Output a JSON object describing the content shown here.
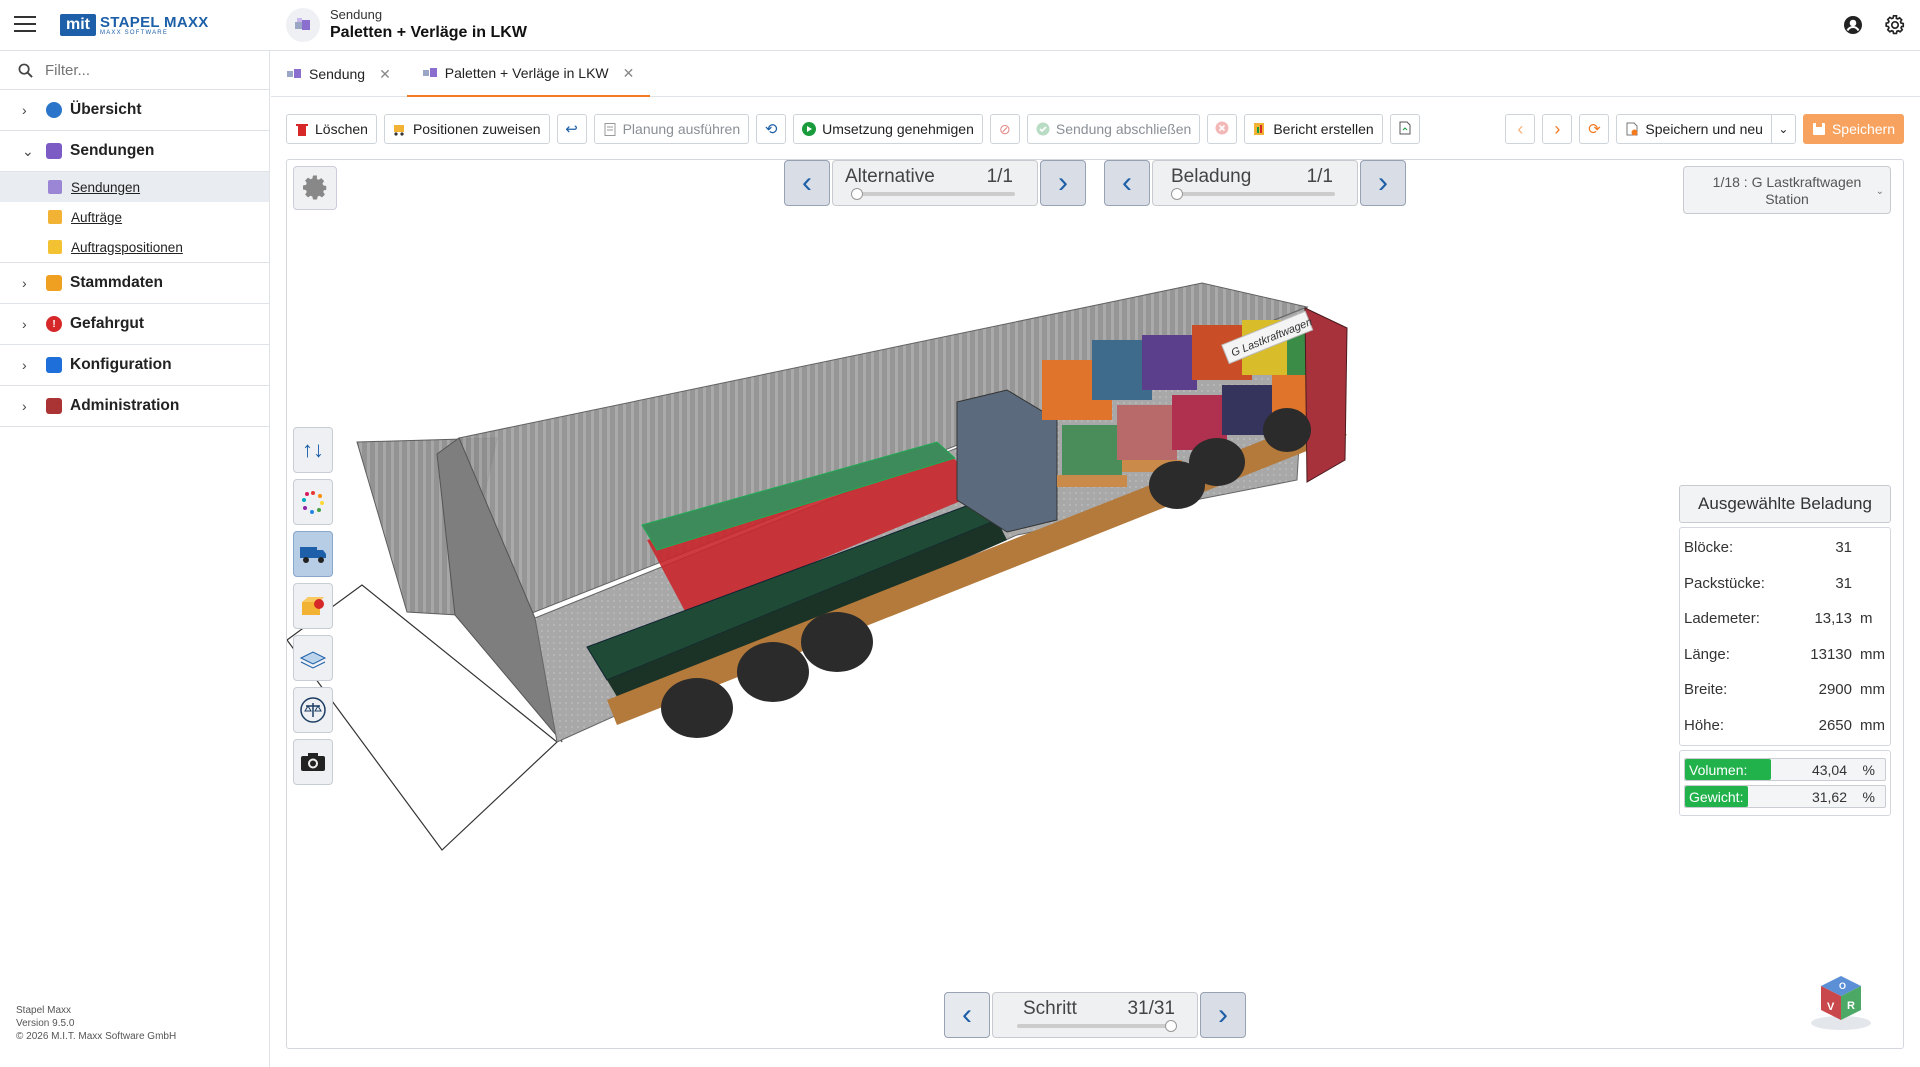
{
  "app": {
    "logo_mark": "mit",
    "brand": "STAPEL MAXX",
    "brand_sub": "MAXX SOFTWARE",
    "doc_type": "Sendung",
    "doc_title": "Paletten + Verläge in LKW"
  },
  "sidebar": {
    "filter_placeholder": "Filter...",
    "items": [
      {
        "label": "Übersicht",
        "color": "#2a74c9"
      },
      {
        "label": "Sendungen",
        "color": "#7c5cc4",
        "expanded": true
      },
      {
        "label": "Stammdaten",
        "color": "#f0a020"
      },
      {
        "label": "Gefahrgut",
        "color": "#d62828"
      },
      {
        "label": "Konfiguration",
        "color": "#1e6fd9"
      },
      {
        "label": "Administration",
        "color": "#a33"
      }
    ],
    "sub_items": [
      {
        "label": "Sendungen",
        "active": true
      },
      {
        "label": "Aufträge"
      },
      {
        "label": "Auftragspositionen"
      }
    ],
    "footer": {
      "name": "Stapel Maxx",
      "version": "Version 9.5.0",
      "copyright": "© 2026 M.I.T. Maxx Software GmbH"
    }
  },
  "tabs": [
    {
      "label": "Sendung",
      "active": false
    },
    {
      "label": "Paletten + Verläge in LKW",
      "active": true
    }
  ],
  "toolbar": {
    "delete": "Löschen",
    "assign": "Positionen zuweisen",
    "plan": "Planung ausführen",
    "approve": "Umsetzung genehmigen",
    "finish": "Sendung abschließen",
    "report": "Bericht erstellen",
    "save_new": "Speichern und neu",
    "save": "Speichern"
  },
  "viewer": {
    "alternative_label": "Alternative",
    "alternative_value": "1/1",
    "loading_label": "Beladung",
    "loading_value": "1/1",
    "station_line1": "1/18 : G Lastkraftwagen",
    "station_line2": "Station",
    "step_label": "Schritt",
    "step_value": "31/31",
    "truck_sign": "G Lastkraftwagen",
    "cube_letters": [
      "R",
      "V",
      "O"
    ]
  },
  "panel": {
    "title": "Ausgewählte Beladung",
    "rows": [
      {
        "label": "Blöcke:",
        "value": "31",
        "unit": ""
      },
      {
        "label": "Packstücke:",
        "value": "31",
        "unit": ""
      },
      {
        "label": "Lademeter:",
        "value": "13,13",
        "unit": "m"
      },
      {
        "label": "Länge:",
        "value": "13130",
        "unit": "mm"
      },
      {
        "label": "Breite:",
        "value": "2900",
        "unit": "mm"
      },
      {
        "label": "Höhe:",
        "value": "2650",
        "unit": "mm"
      }
    ],
    "volume": {
      "label": "Volumen:",
      "value": "43,04",
      "unit": "%",
      "percent": 43.04
    },
    "weight": {
      "label": "Gewicht:",
      "value": "31,62",
      "unit": "%",
      "percent": 31.62
    }
  },
  "colors": {
    "accent": "#f47a20",
    "brand": "#1d5fa8",
    "bar_fill": "#22b24c"
  }
}
